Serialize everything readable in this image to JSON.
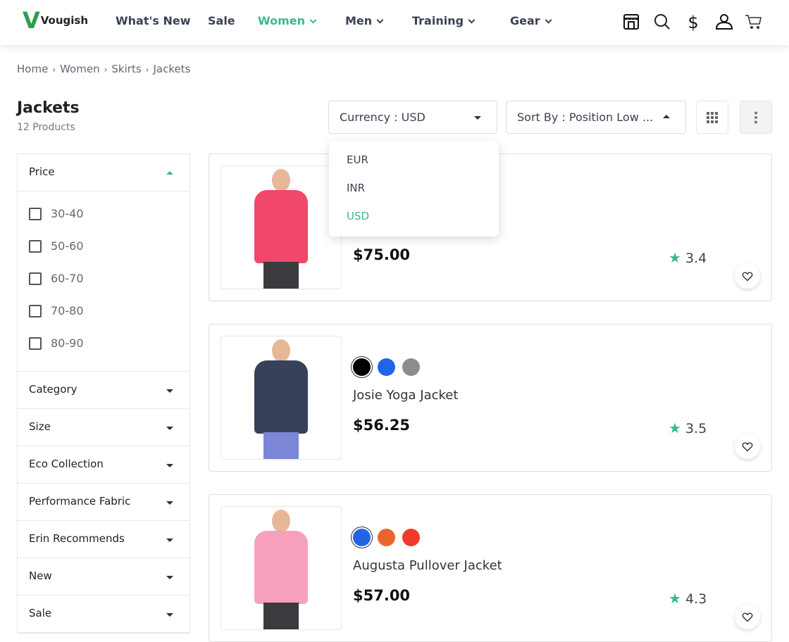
{
  "header": {
    "logo_letter": "V",
    "logo_text": "Vougish",
    "nav": [
      {
        "label": "What's New"
      },
      {
        "label": "Sale"
      },
      {
        "label": "Women",
        "active": true
      },
      {
        "label": "Men"
      },
      {
        "label": "Training"
      },
      {
        "label": "Gear"
      }
    ],
    "icons": [
      "store-icon",
      "search-icon",
      "dollar-icon",
      "user-icon",
      "cart-icon"
    ]
  },
  "breadcrumb": [
    "Home",
    "Women",
    "Skirts",
    "Jackets"
  ],
  "page": {
    "title": "Jackets",
    "count": "12 Products"
  },
  "toolbar": {
    "currency": "Currency : USD",
    "sort": "Sort By : Position Low ..."
  },
  "currency_dropdown": {
    "options": [
      "EUR",
      "INR",
      "USD"
    ],
    "selected": "USD"
  },
  "filters": {
    "price": {
      "label": "Price",
      "options": [
        "30-40",
        "50-60",
        "60-70",
        "70-80",
        "80-90"
      ]
    },
    "sections": [
      "Category",
      "Size",
      "Eco Collection",
      "Performance Fabric",
      "Erin Recommends",
      "New",
      "Sale"
    ]
  },
  "products": [
    {
      "name": "",
      "price": "$75.00",
      "rating": "3.4",
      "colors": [],
      "jacket_color": "#f0476b",
      "pants_color": "#3a3a3f"
    },
    {
      "name": "Josie Yoga Jacket",
      "price": "$56.25",
      "rating": "3.5",
      "colors": [
        "#000000",
        "#2264e8",
        "#8c8c8c"
      ],
      "jacket_color": "#39405a",
      "pants_color": "#7b86d6"
    },
    {
      "name": "Augusta Pullover Jacket",
      "price": "$57.00",
      "rating": "4.3",
      "colors": [
        "#2264e8",
        "#e8662b",
        "#f03b2b"
      ],
      "jacket_color": "#f7a0bd",
      "pants_color": "#3a3a3f"
    }
  ],
  "colors": {
    "accent": "#3cb98a"
  }
}
